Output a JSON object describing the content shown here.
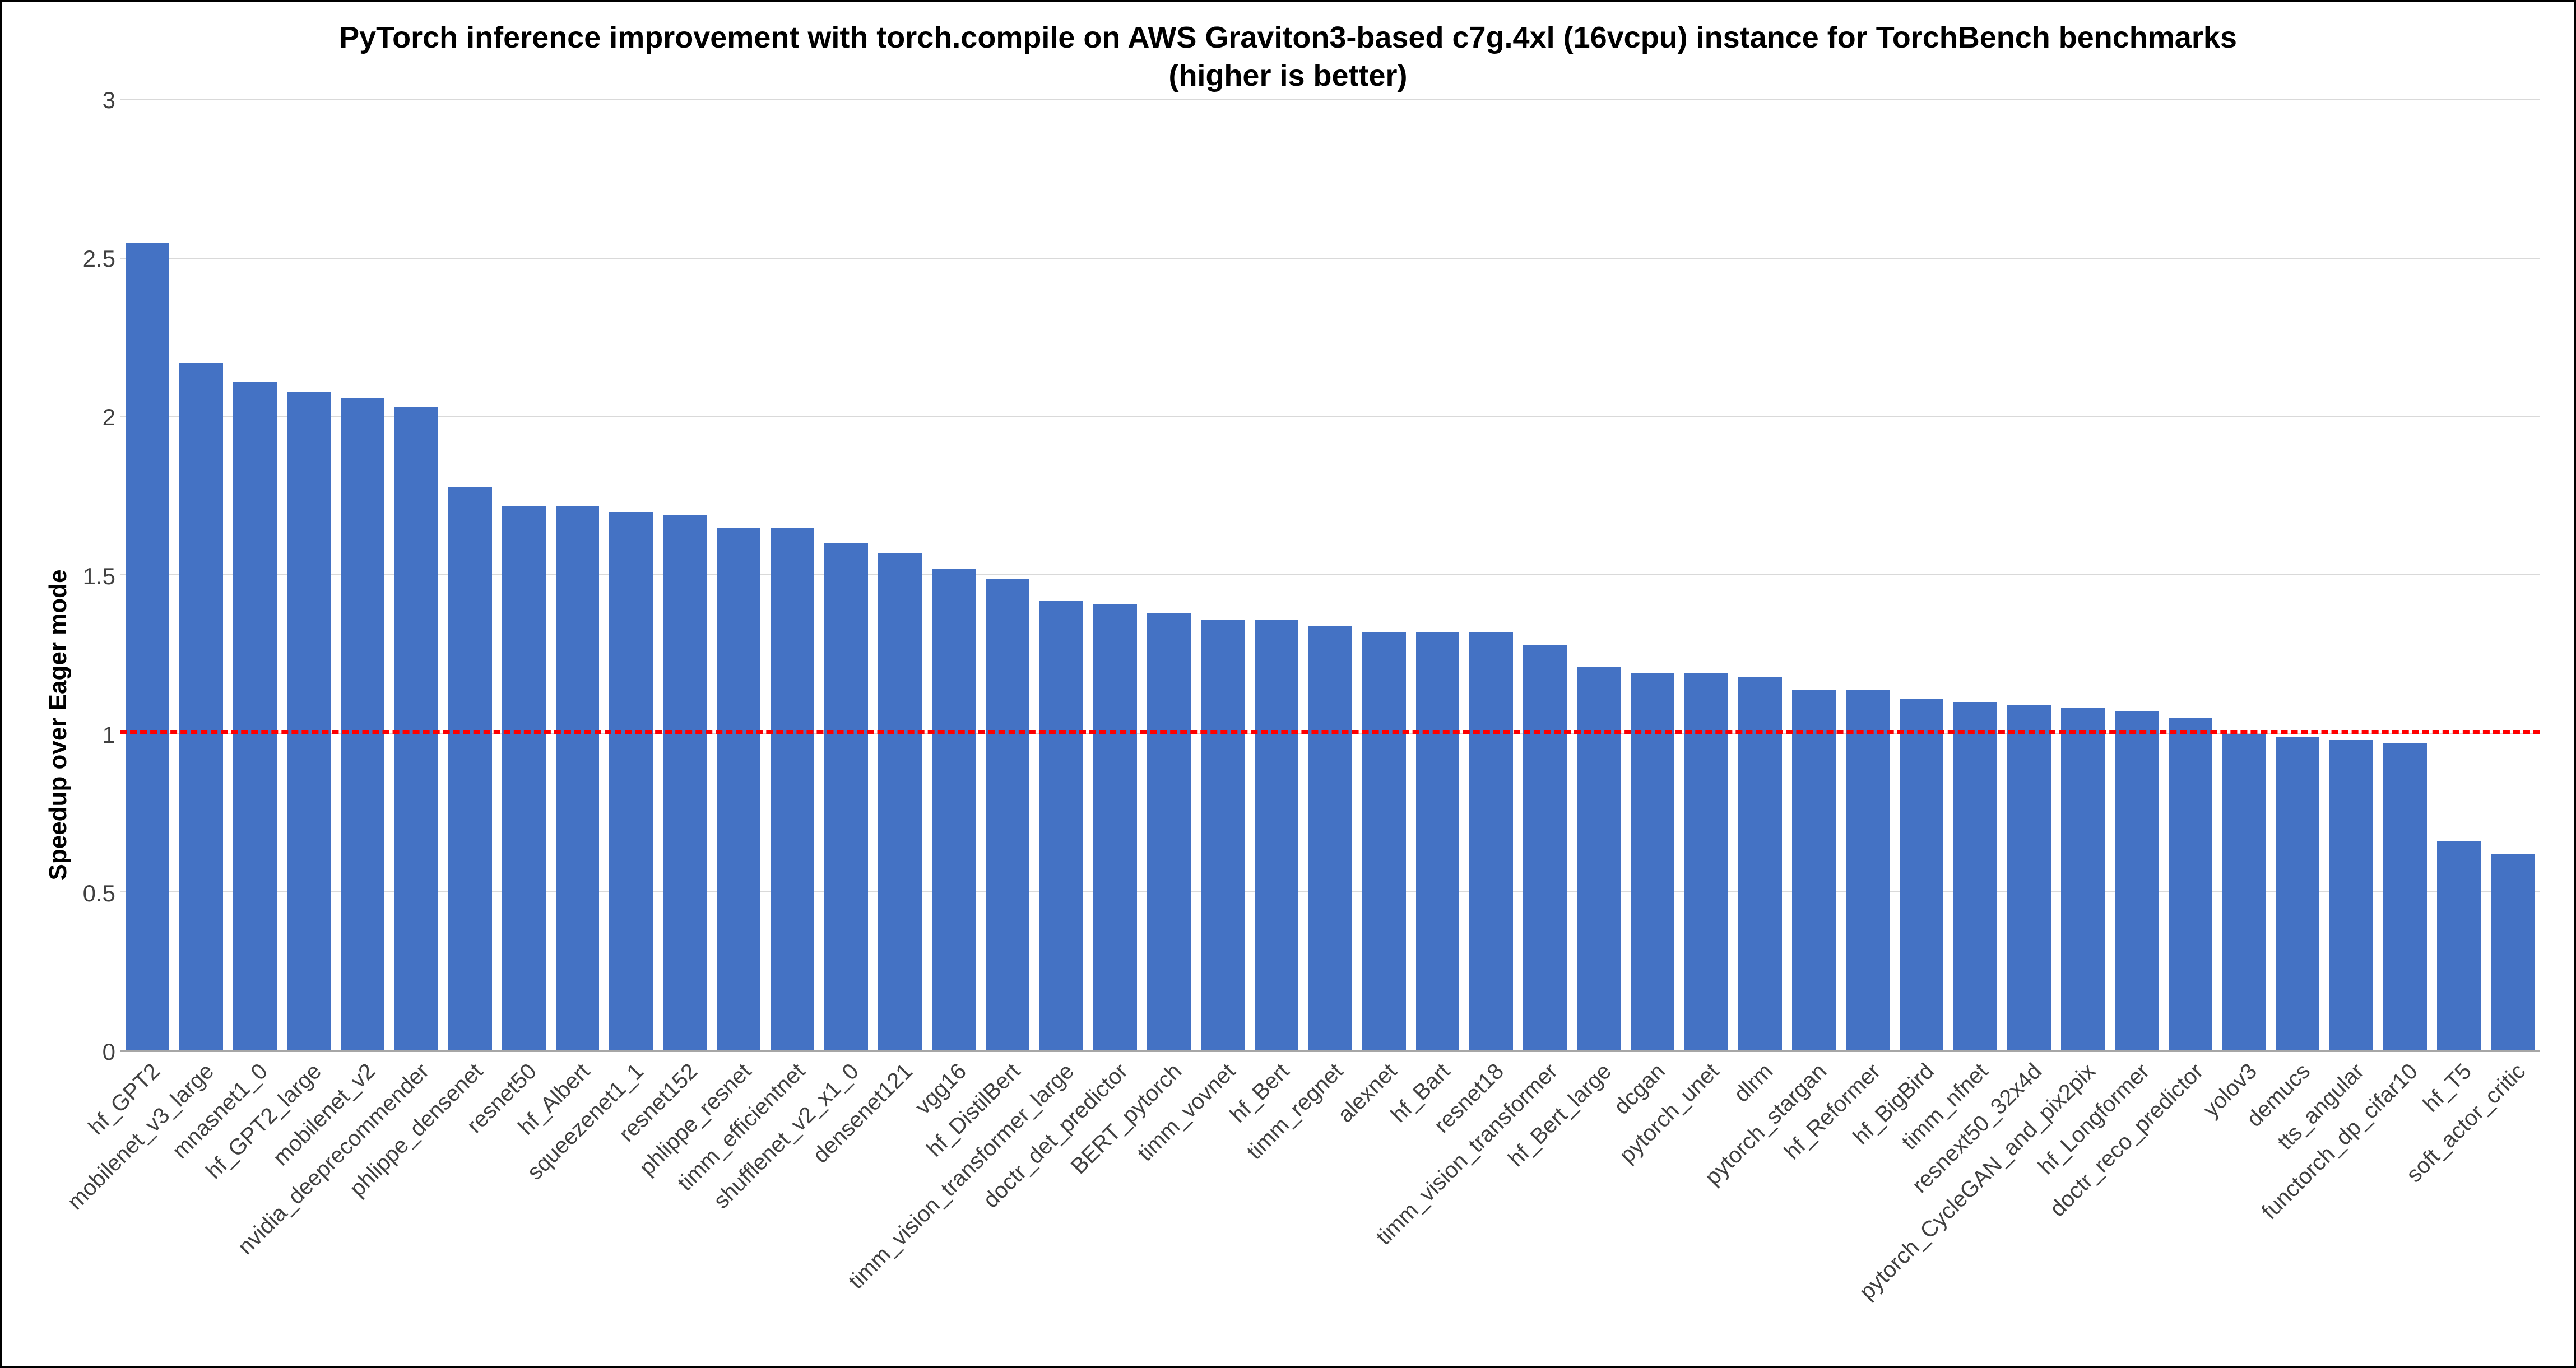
{
  "chart_data": {
    "type": "bar",
    "title_line1": "PyTorch inference improvement with torch.compile on AWS Graviton3-based c7g.4xl (16vcpu) instance for TorchBench benchmarks",
    "title_line2": "(higher is better)",
    "ylabel": "Speedup over Eager mode",
    "xlabel": "",
    "ylim": [
      0,
      3
    ],
    "yticks": [
      0,
      0.5,
      1,
      1.5,
      2,
      2.5,
      3
    ],
    "reference_line": 1.0,
    "bar_color": "#4472c4",
    "reference_color": "#ff0000",
    "categories": [
      "hf_GPT2",
      "mobilenet_v3_large",
      "mnasnet1_0",
      "hf_GPT2_large",
      "mobilenet_v2",
      "nvidia_deeprecommender",
      "phlippe_densenet",
      "resnet50",
      "hf_Albert",
      "squeezenet1_1",
      "resnet152",
      "phlippe_resnet",
      "timm_efficientnet",
      "shufflenet_v2_x1_0",
      "densenet121",
      "vgg16",
      "hf_DistilBert",
      "timm_vision_transformer_large",
      "doctr_det_predictor",
      "BERT_pytorch",
      "timm_vovnet",
      "hf_Bert",
      "timm_regnet",
      "alexnet",
      "hf_Bart",
      "resnet18",
      "timm_vision_transformer",
      "hf_Bert_large",
      "dcgan",
      "pytorch_unet",
      "dlrm",
      "pytorch_stargan",
      "hf_Reformer",
      "hf_BigBird",
      "timm_nfnet",
      "resnext50_32x4d",
      "pytorch_CycleGAN_and_pix2pix",
      "hf_Longformer",
      "doctr_reco_predictor",
      "yolov3",
      "demucs",
      "tts_angular",
      "functorch_dp_cifar10",
      "hf_T5",
      "soft_actor_critic"
    ],
    "values": [
      2.55,
      2.17,
      2.11,
      2.08,
      2.06,
      2.03,
      1.78,
      1.72,
      1.72,
      1.7,
      1.69,
      1.65,
      1.65,
      1.6,
      1.57,
      1.52,
      1.49,
      1.42,
      1.41,
      1.38,
      1.36,
      1.36,
      1.34,
      1.32,
      1.32,
      1.32,
      1.28,
      1.21,
      1.19,
      1.19,
      1.18,
      1.14,
      1.14,
      1.11,
      1.1,
      1.09,
      1.08,
      1.07,
      1.05,
      1.0,
      0.99,
      0.98,
      0.97,
      0.66,
      0.62
    ]
  }
}
